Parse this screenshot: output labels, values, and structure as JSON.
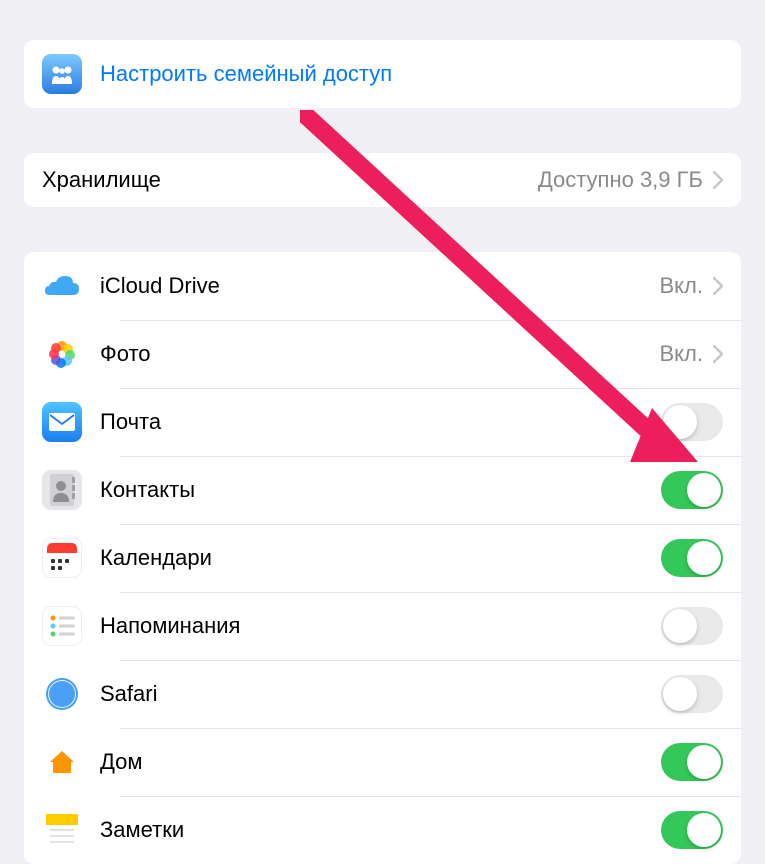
{
  "family": {
    "label": "Настроить семейный доступ"
  },
  "storage": {
    "label": "Хранилище",
    "value": "Доступно 3,9 ГБ"
  },
  "services": [
    {
      "label": "iCloud Drive",
      "value": "Вкл.",
      "nav": true
    },
    {
      "label": "Фото",
      "value": "Вкл.",
      "nav": true
    },
    {
      "label": "Почта",
      "toggle": false
    },
    {
      "label": "Контакты",
      "toggle": true
    },
    {
      "label": "Календари",
      "toggle": true
    },
    {
      "label": "Напоминания",
      "toggle": false
    },
    {
      "label": "Safari",
      "toggle": false
    },
    {
      "label": "Дом",
      "toggle": true
    },
    {
      "label": "Заметки",
      "toggle": true
    }
  ],
  "colors": {
    "link": "#007aff",
    "toggle_on": "#34c759",
    "background": "#efeff4"
  },
  "annotation": {
    "arrow_color": "#ed1e5c"
  }
}
